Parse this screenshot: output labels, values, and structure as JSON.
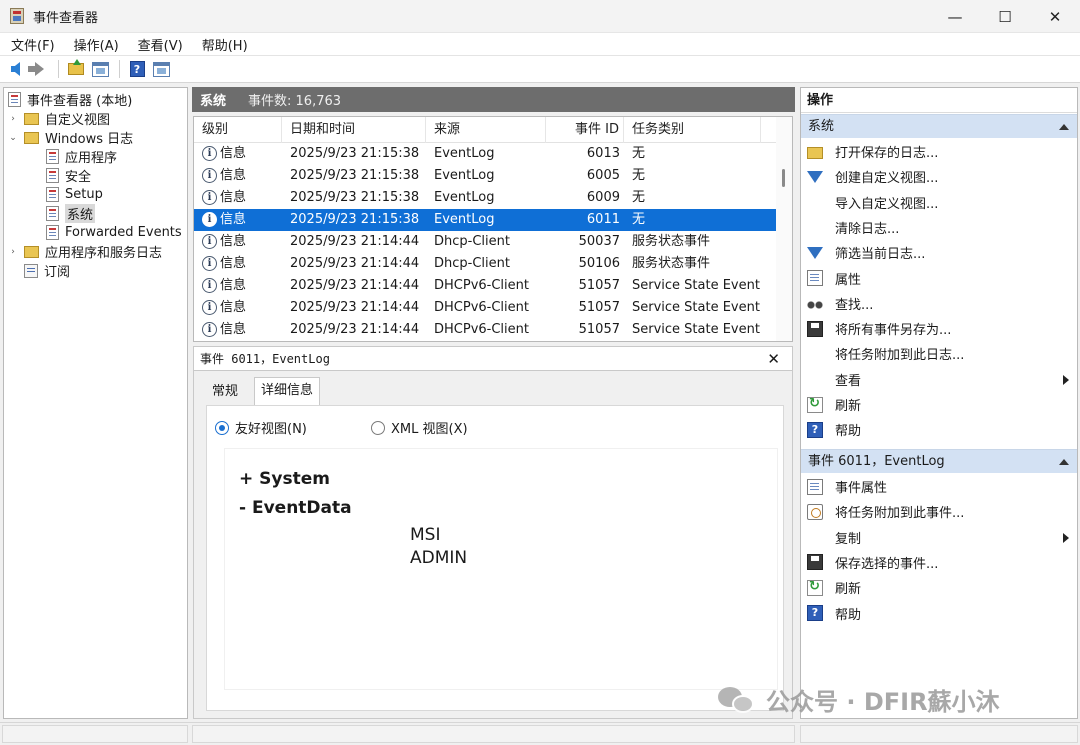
{
  "window": {
    "title": "事件查看器",
    "min": "—",
    "max": "☐",
    "close": "✕"
  },
  "menu": [
    "文件(F)",
    "操作(A)",
    "查看(V)",
    "帮助(H)"
  ],
  "toolbar": {
    "icons": [
      "back-icon",
      "forward-icon",
      "folder-up-icon",
      "console-tree-icon",
      "help-icon",
      "action-pane-icon"
    ],
    "help_glyph": "?"
  },
  "tree": {
    "root": "事件查看器 (本地)",
    "custom_views": "自定义视图",
    "windows_logs": "Windows 日志",
    "application": "应用程序",
    "security": "安全",
    "setup": "Setup",
    "system": "系统",
    "forwarded": "Forwarded Events",
    "app_service_logs": "应用程序和服务日志",
    "subscriptions": "订阅",
    "collapsed_glyph": "›",
    "expanded_glyph": "⌄"
  },
  "center": {
    "title": "系统",
    "count": "事件数: 16,763"
  },
  "event_list": {
    "columns": [
      "级别",
      "日期和时间",
      "来源",
      "事件 ID",
      "任务类别"
    ],
    "rows": [
      {
        "level": "信息",
        "datetime": "2025/9/23 21:15:38",
        "source": "EventLog",
        "id": "6013",
        "category": "无"
      },
      {
        "level": "信息",
        "datetime": "2025/9/23 21:15:38",
        "source": "EventLog",
        "id": "6005",
        "category": "无"
      },
      {
        "level": "信息",
        "datetime": "2025/9/23 21:15:38",
        "source": "EventLog",
        "id": "6009",
        "category": "无"
      },
      {
        "level": "信息",
        "datetime": "2025/9/23 21:15:38",
        "source": "EventLog",
        "id": "6011",
        "category": "无"
      },
      {
        "level": "信息",
        "datetime": "2025/9/23 21:14:44",
        "source": "Dhcp-Client",
        "id": "50037",
        "category": "服务状态事件"
      },
      {
        "level": "信息",
        "datetime": "2025/9/23 21:14:44",
        "source": "Dhcp-Client",
        "id": "50106",
        "category": "服务状态事件"
      },
      {
        "level": "信息",
        "datetime": "2025/9/23 21:14:44",
        "source": "DHCPv6-Client",
        "id": "51057",
        "category": "Service State Event"
      },
      {
        "level": "信息",
        "datetime": "2025/9/23 21:14:44",
        "source": "DHCPv6-Client",
        "id": "51057",
        "category": "Service State Event"
      },
      {
        "level": "信息",
        "datetime": "2025/9/23 21:14:44",
        "source": "DHCPv6-Client",
        "id": "51057",
        "category": "Service State Event"
      }
    ],
    "selected_index": 3,
    "info_glyph": "i"
  },
  "detail": {
    "title": "事件 6011，EventLog",
    "close": "✕",
    "tabs": [
      "常规",
      "详细信息"
    ],
    "active_tab": 1,
    "radio_friendly": "友好视图(N)",
    "radio_xml": "XML 视图(X)",
    "system_node": "+  System",
    "eventdata_node": "-  EventData",
    "values": [
      "MSI",
      "ADMIN"
    ]
  },
  "actions": {
    "title": "操作",
    "group1": "系统",
    "group1_items": [
      {
        "label": "打开保存的日志...",
        "icon": "folder-open-icon"
      },
      {
        "label": "创建自定义视图...",
        "icon": "filter-icon"
      },
      {
        "label": "导入自定义视图...",
        "icon": ""
      },
      {
        "label": "清除日志...",
        "icon": ""
      },
      {
        "label": "筛选当前日志...",
        "icon": "filter-icon"
      },
      {
        "label": "属性",
        "icon": "properties-icon"
      },
      {
        "label": "查找...",
        "icon": "binoculars-icon"
      },
      {
        "label": "将所有事件另存为...",
        "icon": "save-icon"
      },
      {
        "label": "将任务附加到此日志...",
        "icon": ""
      },
      {
        "label": "查看",
        "icon": ""
      },
      {
        "label": "刷新",
        "icon": "refresh-icon"
      },
      {
        "label": "帮助",
        "icon": "help-icon"
      }
    ],
    "group2": "事件 6011，EventLog",
    "group2_items": [
      {
        "label": "事件属性",
        "icon": "properties-icon"
      },
      {
        "label": "将任务附加到此事件...",
        "icon": "task-icon"
      },
      {
        "label": "复制",
        "icon": ""
      },
      {
        "label": "保存选择的事件...",
        "icon": "save-icon"
      },
      {
        "label": "刷新",
        "icon": "refresh-icon"
      },
      {
        "label": "帮助",
        "icon": "help-icon"
      }
    ]
  },
  "watermark": "公众号 · DFIR蘇小沐"
}
